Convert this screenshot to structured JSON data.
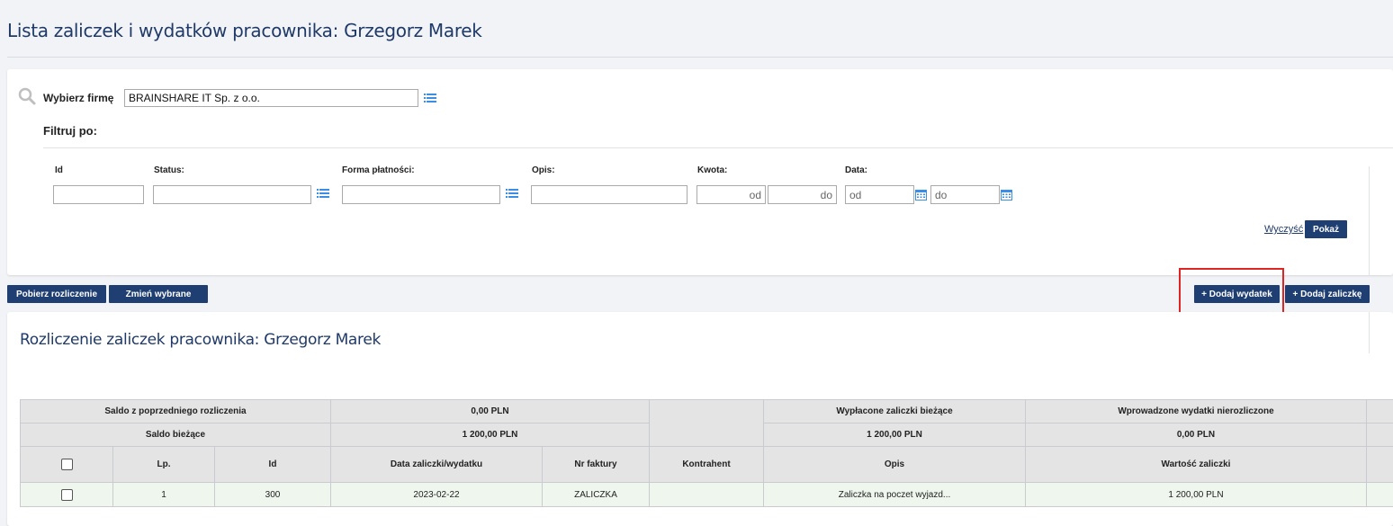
{
  "page": {
    "title": "Lista zaliczek i wydatków pracownika: Grzegorz Marek"
  },
  "filters": {
    "company_label": "Wybierz firmę",
    "company_value": "BRAINSHARE IT Sp. z o.o.",
    "filter_title": "Filtruj po:",
    "id_label": "Id",
    "status_label": "Status:",
    "payment_label": "Forma płatności:",
    "description_label": "Opis:",
    "amount_label": "Kwota:",
    "amount_from_placeholder": "od",
    "amount_to_placeholder": "do",
    "date_label": "Data:",
    "date_from_placeholder": "od",
    "date_to_placeholder": "do",
    "clear_link": "Wyczyść",
    "show_button": "Pokaż"
  },
  "actions": {
    "get_settlement": "Pobierz rozliczenie",
    "change_selected": "Zmień wybrane",
    "add_expense": "+ Dodaj wydatek",
    "add_advance": "+ Dodaj zaliczkę"
  },
  "settlement": {
    "title": "Rozliczenie zaliczek pracownika: Grzegorz Marek",
    "prev_balance_label": "Saldo z poprzedniego rozliczenia",
    "prev_balance_value": "0,00 PLN",
    "current_balance_label": "Saldo bieżące",
    "current_balance_value": "1 200,00 PLN",
    "paid_advances_label": "Wypłacone zaliczki bieżące",
    "paid_advances_value": "1 200,00 PLN",
    "unsettled_expenses_label": "Wprowadzone wydatki nierozliczone",
    "unsettled_expenses_value": "0,00 PLN",
    "columns": [
      "Lp.",
      "Id",
      "Data zaliczki/wydatku",
      "Nr faktury",
      "Kontrahent",
      "Opis",
      "Wartość zaliczki"
    ],
    "rows": [
      {
        "lp": "1",
        "id": "300",
        "date": "2023-02-22",
        "invoice": "ZALICZKA",
        "contractor": "",
        "description": "Zaliczka na poczet wyjazd...",
        "value": "1 200,00 PLN"
      }
    ]
  },
  "colors": {
    "primary": "#1f3f73",
    "title": "#1f3a68",
    "highlight": "#e02424",
    "row_bg": "#eef6ee"
  }
}
